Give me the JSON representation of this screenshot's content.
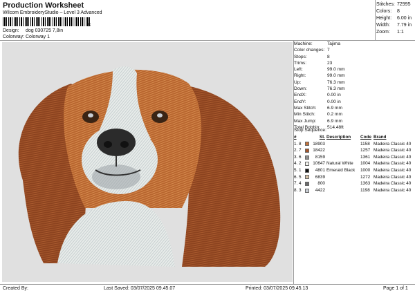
{
  "header": {
    "title": "Production Worksheet",
    "subtitle": "Wilcom EmbroideryStudio – Level 3 Advanced",
    "barcode_end": "3",
    "design_label": "Design:",
    "design_value": "dog 030725 7,8in",
    "colorway_label": "Colorway:",
    "colorway_value": "Colorway 1"
  },
  "stats": [
    {
      "label": "Stitches:",
      "value": "72995"
    },
    {
      "label": "Colors:",
      "value": "8"
    },
    {
      "label": "Height:",
      "value": "6.00 in"
    },
    {
      "label": "Width:",
      "value": "7.79 in"
    },
    {
      "label": "Zoom:",
      "value": "1:1"
    }
  ],
  "machine": [
    {
      "label": "Machine:",
      "value": "Tajima"
    },
    {
      "label": "Color changes:",
      "value": "7"
    },
    {
      "label": "Stops:",
      "value": "8"
    },
    {
      "label": "Trims:",
      "value": "23"
    },
    {
      "label": "Left:",
      "value": "99.0 mm"
    },
    {
      "label": "Right:",
      "value": "99.0 mm"
    },
    {
      "label": "Up:",
      "value": "76.3 mm"
    },
    {
      "label": "Down:",
      "value": "76.3 mm"
    },
    {
      "label": "EndX:",
      "value": "0.00 in"
    },
    {
      "label": "EndY:",
      "value": "0.00 in"
    },
    {
      "label": "Max Stitch:",
      "value": "6.9 mm"
    },
    {
      "label": "Min Stitch:",
      "value": "0.2 mm"
    },
    {
      "label": "Max Jump:",
      "value": "6.9 mm"
    },
    {
      "label": "Total Bobbin:",
      "value": "514.48ft"
    }
  ],
  "stop_sequence": {
    "title": "Stop Sequence:",
    "headers": {
      "num": "#",
      "st": "St.",
      "desc": "Description",
      "code": "Code",
      "brand": "Brand"
    },
    "rows": [
      {
        "num": "1.",
        "col": "8",
        "color": "#c4733b",
        "st": "18903",
        "desc": "",
        "code": "1158",
        "brand": "Madeira Classic 40"
      },
      {
        "num": "2.",
        "col": "7",
        "color": "#a4542a",
        "st": "18422",
        "desc": "",
        "code": "1257",
        "brand": "Madeira Classic 40"
      },
      {
        "num": "3.",
        "col": "6",
        "color": "#8f8f8f",
        "st": "8159",
        "desc": "",
        "code": "1361",
        "brand": "Madeira Classic 40"
      },
      {
        "num": "4.",
        "col": "2",
        "color": "#f4f4ef",
        "st": "10647",
        "desc": "Natural White",
        "code": "1004",
        "brand": "Madeira Classic 40"
      },
      {
        "num": "5.",
        "col": "1",
        "color": "#141414",
        "st": "4801",
        "desc": "Emerald Black",
        "code": "1000",
        "brand": "Madeira Classic 40"
      },
      {
        "num": "6.",
        "col": "5",
        "color": "#d5c1a6",
        "st": "6839",
        "desc": "",
        "code": "1272",
        "brand": "Madeira Classic 40"
      },
      {
        "num": "7.",
        "col": "4",
        "color": "#6b6b6b",
        "st": "800",
        "desc": "",
        "code": "1363",
        "brand": "Madeira Classic 40"
      },
      {
        "num": "8.",
        "col": "3",
        "color": "#c9ced4",
        "st": "4422",
        "desc": "",
        "code": "1198",
        "brand": "Madeira Classic 40"
      }
    ]
  },
  "footer": {
    "created_by": "Created By:",
    "last_saved": "Last Saved: 03/07/2025 09.45.07",
    "printed": "Printed: 03/07/2025 09.45.13",
    "page": "Page 1 of 1"
  },
  "colors": {
    "brown_light": "#c4733b",
    "brown_dark": "#a4542a",
    "white": "#eef1ee",
    "gray": "#8f8f8f",
    "design_bg": "#e0e0e0"
  }
}
